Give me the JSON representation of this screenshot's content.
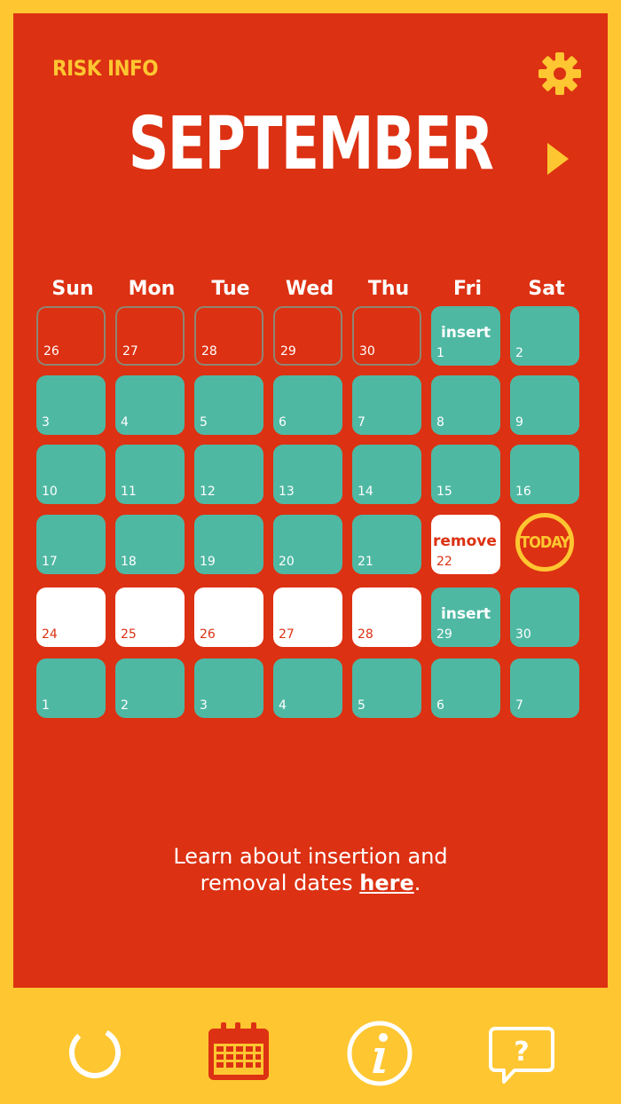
{
  "header": {
    "risk_info_label": "RISK INFO",
    "month": "SEPTEMBER",
    "settings_icon": "gear-icon",
    "next_icon": "next-month-arrow-icon"
  },
  "weekdays": [
    "Sun",
    "Mon",
    "Tue",
    "Wed",
    "Thu",
    "Fri",
    "Sat"
  ],
  "weeks": [
    [
      {
        "day": "26",
        "style": "outside",
        "event": ""
      },
      {
        "day": "27",
        "style": "outside",
        "event": ""
      },
      {
        "day": "28",
        "style": "outside",
        "event": ""
      },
      {
        "day": "29",
        "style": "outside",
        "event": ""
      },
      {
        "day": "30",
        "style": "outside",
        "event": ""
      },
      {
        "day": "1",
        "style": "teal",
        "event": "insert"
      },
      {
        "day": "2",
        "style": "teal",
        "event": ""
      }
    ],
    [
      {
        "day": "3",
        "style": "teal",
        "event": ""
      },
      {
        "day": "4",
        "style": "teal",
        "event": ""
      },
      {
        "day": "5",
        "style": "teal",
        "event": ""
      },
      {
        "day": "6",
        "style": "teal",
        "event": ""
      },
      {
        "day": "7",
        "style": "teal",
        "event": ""
      },
      {
        "day": "8",
        "style": "teal",
        "event": ""
      },
      {
        "day": "9",
        "style": "teal",
        "event": ""
      }
    ],
    [
      {
        "day": "10",
        "style": "teal",
        "event": ""
      },
      {
        "day": "11",
        "style": "teal",
        "event": ""
      },
      {
        "day": "12",
        "style": "teal",
        "event": ""
      },
      {
        "day": "13",
        "style": "teal",
        "event": ""
      },
      {
        "day": "14",
        "style": "teal",
        "event": ""
      },
      {
        "day": "15",
        "style": "teal",
        "event": ""
      },
      {
        "day": "16",
        "style": "teal",
        "event": ""
      }
    ],
    [
      {
        "day": "17",
        "style": "teal",
        "event": ""
      },
      {
        "day": "18",
        "style": "teal",
        "event": ""
      },
      {
        "day": "19",
        "style": "teal",
        "event": ""
      },
      {
        "day": "20",
        "style": "teal",
        "event": ""
      },
      {
        "day": "21",
        "style": "teal",
        "event": ""
      },
      {
        "day": "22",
        "style": "white",
        "event": "remove"
      },
      {
        "day": "",
        "style": "today",
        "event": "TODAY"
      }
    ],
    [
      {
        "day": "24",
        "style": "white",
        "event": ""
      },
      {
        "day": "25",
        "style": "white",
        "event": ""
      },
      {
        "day": "26",
        "style": "white",
        "event": ""
      },
      {
        "day": "27",
        "style": "white",
        "event": ""
      },
      {
        "day": "28",
        "style": "white",
        "event": ""
      },
      {
        "day": "29",
        "style": "teal",
        "event": "insert"
      },
      {
        "day": "30",
        "style": "teal",
        "event": ""
      }
    ],
    [
      {
        "day": "1",
        "style": "teal",
        "event": ""
      },
      {
        "day": "2",
        "style": "teal",
        "event": ""
      },
      {
        "day": "3",
        "style": "teal",
        "event": ""
      },
      {
        "day": "4",
        "style": "teal",
        "event": ""
      },
      {
        "day": "5",
        "style": "teal",
        "event": ""
      },
      {
        "day": "6",
        "style": "teal",
        "event": ""
      },
      {
        "day": "7",
        "style": "teal",
        "event": ""
      }
    ]
  ],
  "learn": {
    "line1": "Learn about insertion and",
    "line2_prefix": "removal dates ",
    "link": "here",
    "suffix": "."
  },
  "tabbar": {
    "items": [
      {
        "icon": "progress-ring-icon"
      },
      {
        "icon": "calendar-icon",
        "active": true
      },
      {
        "icon": "info-icon"
      },
      {
        "icon": "help-chat-icon"
      }
    ]
  },
  "colors": {
    "background": "#fec631",
    "panel": "#dc3112",
    "teal": "#4fb8a3",
    "accent": "#fec631"
  }
}
